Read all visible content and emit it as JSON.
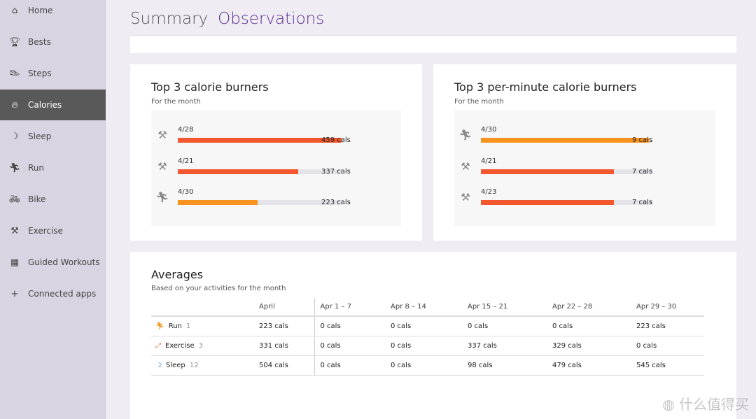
{
  "sidebar": {
    "items": [
      {
        "label": "Home",
        "icon": "home-icon",
        "glyph": "⌂"
      },
      {
        "label": "Bests",
        "icon": "trophy-icon",
        "glyph": "🏆︎"
      },
      {
        "label": "Steps",
        "icon": "shoe-icon",
        "glyph": "👟︎"
      },
      {
        "label": "Calories",
        "icon": "flame-icon",
        "glyph": "🔥︎",
        "active": true
      },
      {
        "label": "Sleep",
        "icon": "moon-icon",
        "glyph": "☽"
      },
      {
        "label": "Run",
        "icon": "runner-icon",
        "glyph": "🏃︎"
      },
      {
        "label": "Bike",
        "icon": "bike-icon",
        "glyph": "🚲︎"
      },
      {
        "label": "Exercise",
        "icon": "dumbbell-icon",
        "glyph": "⚒"
      },
      {
        "label": "Guided Workouts",
        "icon": "guided-workouts-icon",
        "glyph": "▦"
      },
      {
        "label": "Connected apps",
        "icon": "plus-icon",
        "glyph": "+"
      }
    ]
  },
  "header": {
    "tab1": "Summary",
    "tab2": "Observations"
  },
  "colors": {
    "accent": "#5c2d91",
    "exercise": "#f2572d",
    "run": "#f7931e",
    "sleep": "#1a6fc4",
    "track": "#e5e3ea"
  },
  "top_total": {
    "title": "Top 3 calorie burners",
    "subtitle": "For the month",
    "items": [
      {
        "date": "4/28",
        "value": "459 cals",
        "type": "exercise",
        "fill": 100
      },
      {
        "date": "4/21",
        "value": "337 cals",
        "type": "exercise",
        "fill": 73.4
      },
      {
        "date": "4/30",
        "value": "223 cals",
        "type": "run",
        "fill": 48.6
      }
    ]
  },
  "top_per_minute": {
    "title": "Top 3 per-minute calorie burners",
    "subtitle": "For the month",
    "items": [
      {
        "date": "4/30",
        "value": "9 cals",
        "type": "run",
        "fill": 98
      },
      {
        "date": "4/21",
        "value": "7 cals",
        "type": "exercise",
        "fill": 77.5
      },
      {
        "date": "4/23",
        "value": "7 cals",
        "type": "exercise",
        "fill": 77.5
      }
    ]
  },
  "averages": {
    "title": "Averages",
    "subtitle": "Based on your activities for the month",
    "columns": [
      "April",
      "Apr 1 – 7",
      "Apr 8 – 14",
      "Apr 15 – 21",
      "Apr 22 – 28",
      "Apr 29 – 30"
    ],
    "rows": [
      {
        "name": "Run",
        "count": "1",
        "type": "run",
        "glyph": "🏃︎",
        "values": [
          "223 cals",
          "0 cals",
          "0 cals",
          "0 cals",
          "0 cals",
          "223 cals"
        ]
      },
      {
        "name": "Exercise",
        "count": "3",
        "type": "exercise",
        "glyph": "⤢",
        "values": [
          "331 cals",
          "0 cals",
          "0 cals",
          "337 cals",
          "329 cals",
          "0 cals"
        ]
      },
      {
        "name": "Sleep",
        "count": "12",
        "type": "sleep",
        "glyph": "☽",
        "values": [
          "504 cals",
          "0 cals",
          "0 cals",
          "98 cals",
          "479 cals",
          "545 cals"
        ]
      }
    ]
  },
  "watermark": "什么值得买"
}
